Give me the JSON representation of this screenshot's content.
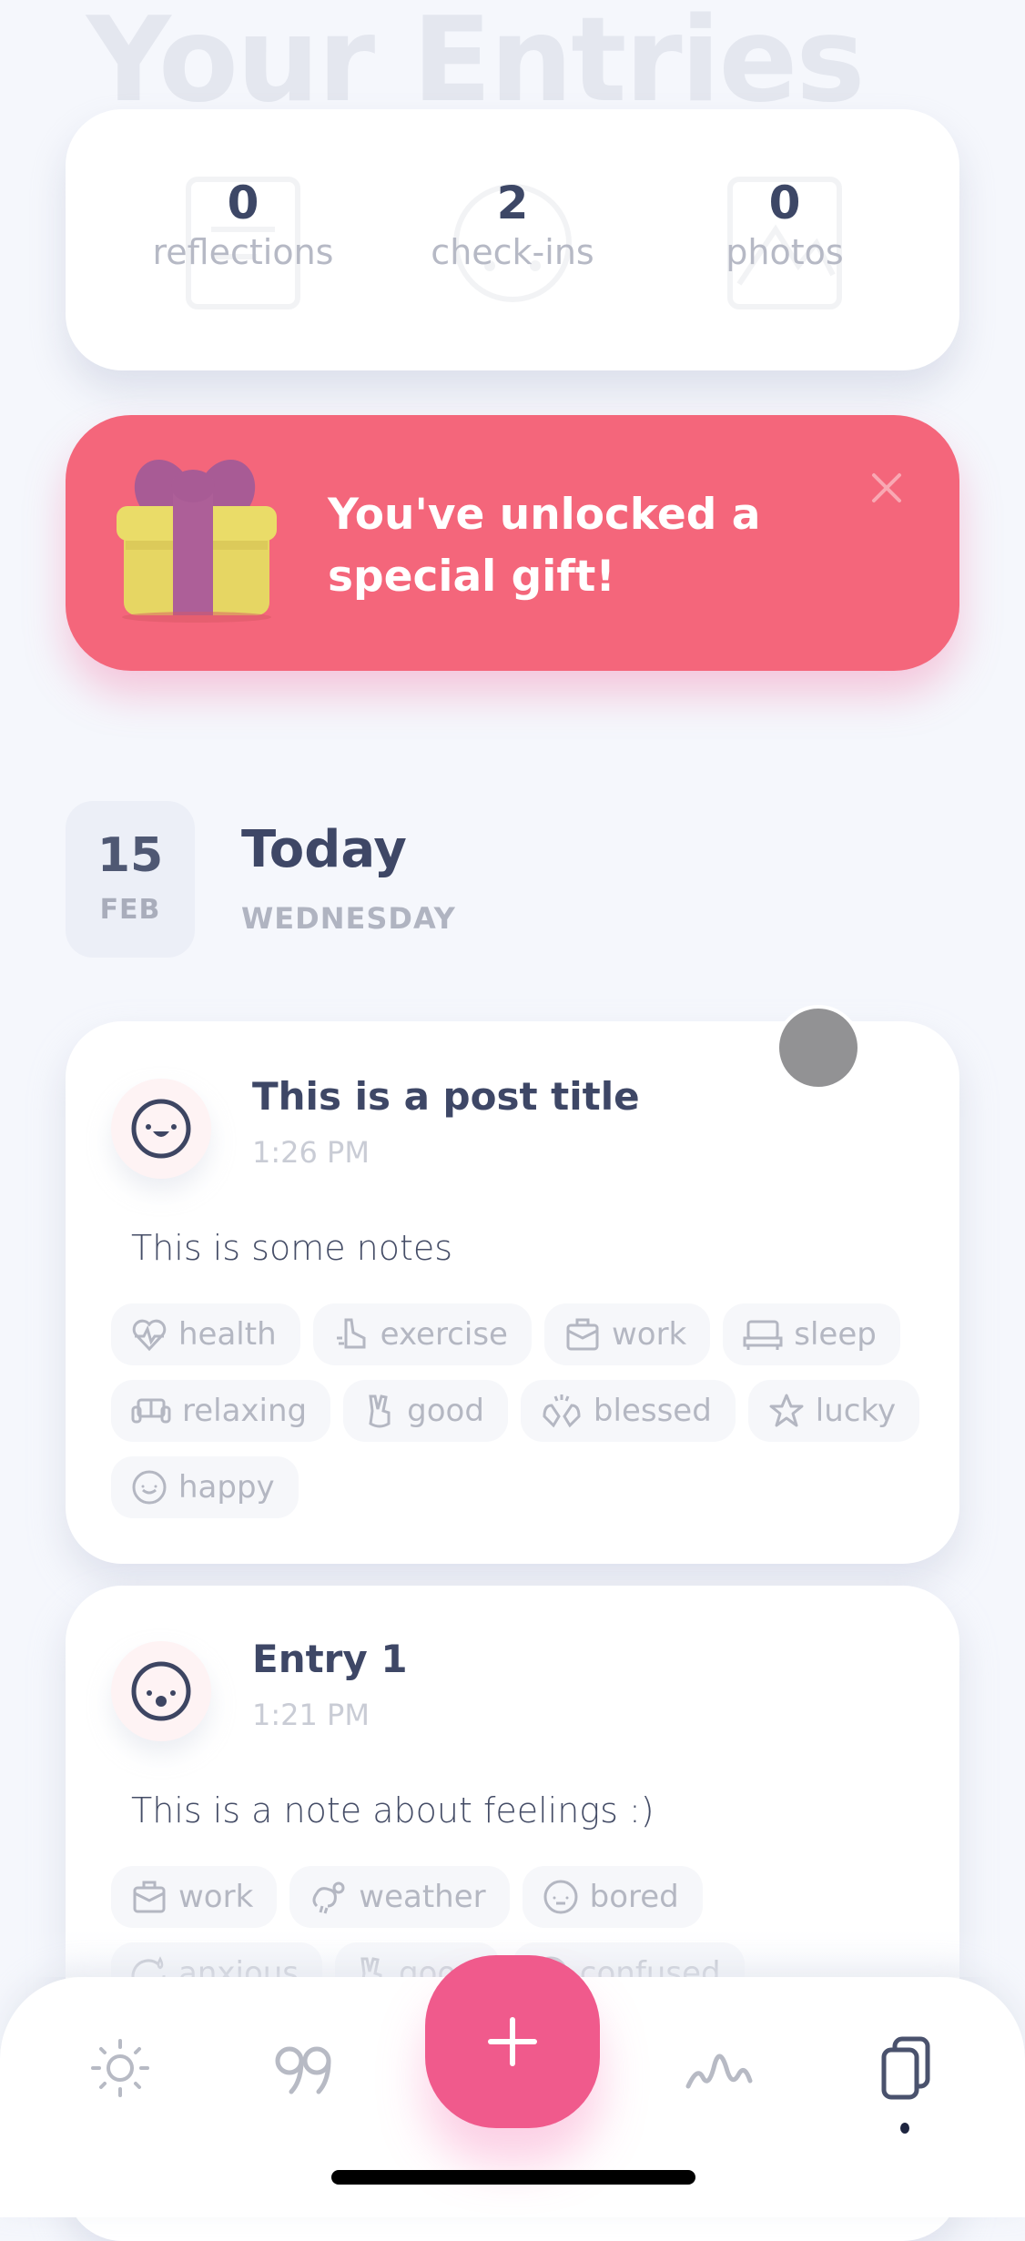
{
  "header": {
    "title": "Your Entries"
  },
  "stats": [
    {
      "value": "0",
      "label": "reflections",
      "icon": "journal-icon"
    },
    {
      "value": "2",
      "label": "check-ins",
      "icon": "face-icon"
    },
    {
      "value": "0",
      "label": "photos",
      "icon": "image-icon"
    }
  ],
  "gift_banner": {
    "message": "You've unlocked a special gift!",
    "line1": "You've unlocked a",
    "line2": "special gift!",
    "icon": "gift-icon",
    "close_icon": "close-icon",
    "color": "#f4667b"
  },
  "date_header": {
    "day": "15",
    "month": "FEB",
    "title": "Today",
    "weekday": "WEDNESDAY"
  },
  "entries": [
    {
      "mood_icon": "laughing-face-icon",
      "title": "This is a post title",
      "time": "1:26 PM",
      "notes": "This is some notes",
      "tags": [
        {
          "label": "health",
          "icon": "heart-pulse-icon"
        },
        {
          "label": "exercise",
          "icon": "running-shoe-icon"
        },
        {
          "label": "work",
          "icon": "briefcase-icon"
        },
        {
          "label": "sleep",
          "icon": "bed-icon"
        },
        {
          "label": "relaxing",
          "icon": "sofa-icon"
        },
        {
          "label": "good",
          "icon": "peace-hand-icon"
        },
        {
          "label": "blessed",
          "icon": "praying-hands-icon"
        },
        {
          "label": "lucky",
          "icon": "star-icon"
        },
        {
          "label": "happy",
          "icon": "smile-icon"
        }
      ]
    },
    {
      "mood_icon": "surprised-face-icon",
      "title": "Entry 1",
      "time": "1:21 PM",
      "notes": "This is a note about feelings :)",
      "tags": [
        {
          "label": "work",
          "icon": "briefcase-icon"
        },
        {
          "label": "weather",
          "icon": "cloud-sun-rain-icon"
        },
        {
          "label": "bored",
          "icon": "bored-face-icon"
        },
        {
          "label": "anxious",
          "icon": "anxious-face-icon"
        },
        {
          "label": "good",
          "icon": "peace-hand-icon"
        },
        {
          "label": "confused",
          "icon": "confused-face-icon"
        }
      ]
    }
  ],
  "bottom_nav": {
    "items": [
      {
        "name": "today",
        "icon": "sun-icon",
        "active": false
      },
      {
        "name": "quotes",
        "icon": "quote-icon",
        "active": false
      },
      {
        "name": "add",
        "icon": "plus-icon",
        "active": false
      },
      {
        "name": "insights",
        "icon": "wave-chart-icon",
        "active": false
      },
      {
        "name": "entries",
        "icon": "cards-icon",
        "active": true
      }
    ],
    "fab_color": "#f05a8c"
  }
}
